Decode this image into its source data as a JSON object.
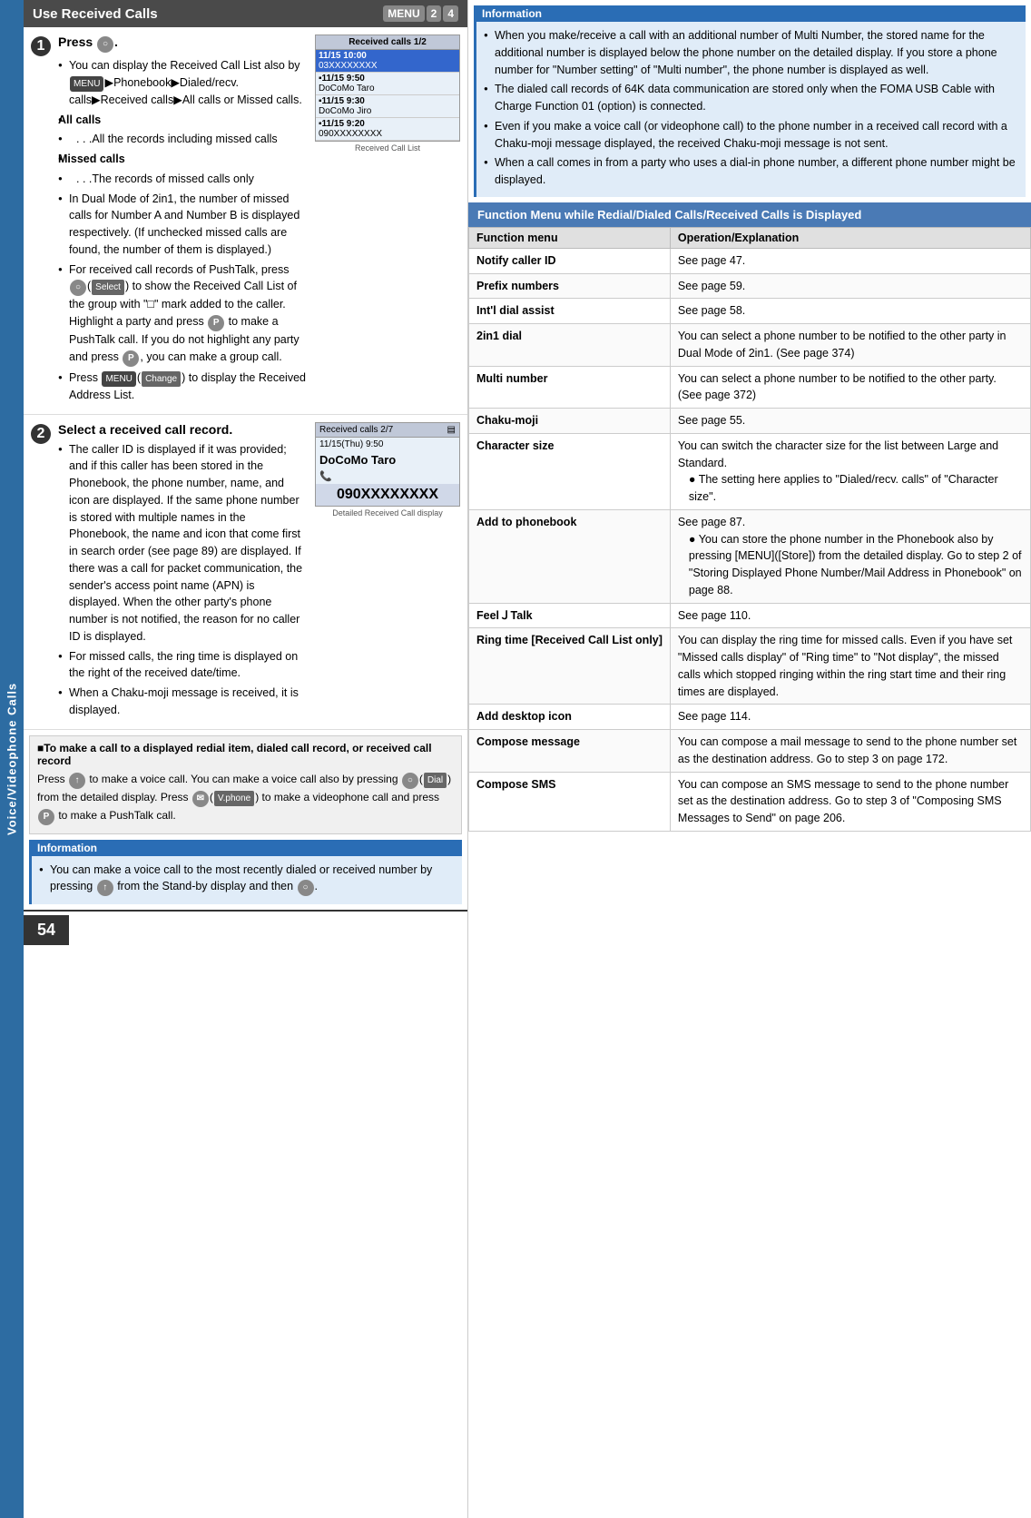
{
  "page_number": "54",
  "side_label": "Voice/Videophone Calls",
  "section_title": "Use Received Calls",
  "menu_numbers": [
    "2",
    "4"
  ],
  "step1": {
    "title": "Press",
    "key": "○",
    "bullets": [
      "You can display the Received Call List also by [MENU]▶Phonebook▶Dialed/recv. calls▶Received calls▶All calls or Missed calls.",
      "All calls",
      "　. . .All the records including missed calls",
      "Missed calls",
      "　. . .The records of missed calls only",
      "In Dual Mode of 2in1, the number of missed calls for Number A and Number B is displayed respectively. (If unchecked missed calls are found, the number of them is displayed.)",
      "For received call records of PushTalk, press ○([Select]) to show the Received Call List of the group with \"□\" mark added to the caller. Highlight a party and press [P] to make a PushTalk call. If you do not highlight any party and press [P], you can make a group call.",
      "Press [MENU]([Change]) to display the Received Address List."
    ],
    "screen_title": "Received calls  1/2",
    "screen_rows": [
      {
        "time": "11/15 10:00",
        "name": "03XXXXXXXX",
        "selected": true
      },
      {
        "time": "11/15  9:50",
        "name": "DoCoMo Taro",
        "selected": false
      },
      {
        "time": "11/15  9:30",
        "name": "DoCoMo Jiro",
        "selected": false
      },
      {
        "time": "11/15  9:20",
        "name": "090XXXXXXXX",
        "selected": false
      }
    ],
    "screen_label": "Received Call List"
  },
  "step2": {
    "title": "Select a received call record.",
    "bullets": [
      "The caller ID is displayed if it was provided; and if this caller has been stored in the Phonebook, the phone number, name, and icon are displayed. If the same phone number is stored with multiple names in the Phonebook, the name and icon that come first in search order (see page 89) are displayed. If there was a call for packet communication, the sender's access point name (APN) is displayed. When the other party's phone number is not notified, the reason for no caller ID is displayed.",
      "For missed calls, the ring time is displayed on the right of the received date/time.",
      "When a Chaku-moji message is received, it is displayed."
    ],
    "screen_title": "Received calls  2/7",
    "screen_date": "11/15(Thu)  9:50",
    "screen_name": "DoCoMo Taro",
    "screen_number": "090XXXXXXXX",
    "screen_label": "Detailed Received Call display"
  },
  "call_box": {
    "title": "■To make a call to a displayed redial item, dialed call record, or received call record",
    "text1": "Press [↑] to make a voice call. You can make a voice call also by pressing ○([Dial]) from the detailed display. Press [✉]([V.phone]) to make a videophone call and press [P] to make a PushTalk call."
  },
  "information_section": {
    "title": "Information",
    "bullets": [
      "You can make a voice call to the most recently dialed or received number by pressing [↑] from the Stand-by display and then ○."
    ]
  },
  "right_info_bullets": [
    "When you make/receive a call with an additional number of Multi Number, the stored name for the additional number is displayed below the phone number on the detailed display. If you store a phone number for \"Number setting\" of \"Multi number\", the phone number is displayed as well.",
    "The dialed call records of 64K data communication are stored only when the FOMA USB Cable with Charge Function 01 (option) is connected.",
    "Even if you make a voice call (or videophone call) to the phone number in a received call record with a Chaku-moji message displayed, the received Chaku-moji message is not sent.",
    "When a call comes in from a party who uses a dial-in phone number, a different phone number might be displayed."
  ],
  "function_menu_title": "Function Menu while Redial/Dialed Calls/Received Calls is Displayed",
  "table_headers": [
    "Function menu",
    "Operation/Explanation"
  ],
  "table_rows": [
    {
      "name": "Notify caller ID",
      "desc": "See page 47."
    },
    {
      "name": "Prefix numbers",
      "desc": "See page 59."
    },
    {
      "name": "Int'l dial assist",
      "desc": "See page 58."
    },
    {
      "name": "2in1 dial",
      "desc": "You can select a phone number to be notified to the other party in Dual Mode of 2in1. (See page 374)"
    },
    {
      "name": "Multi number",
      "desc": "You can select a phone number to be notified to the other party. (See page 372)"
    },
    {
      "name": "Chaku-moji",
      "desc": "See page 55."
    },
    {
      "name": "Character size",
      "desc": "You can switch the character size for the list between Large and Standard.\n●The setting here applies to \"Dialed/recv. calls\" of \"Character size\"."
    },
    {
      "name": "Add to phonebook",
      "desc": "See page 87.\n●You can store the phone number in the Phonebook also by pressing [MENU]([Store]) from the detailed display. Go to step 2 of \"Storing Displayed Phone Number/Mail Address in Phonebook\" on page 88."
    },
    {
      "name": "FeelＪTalk",
      "desc": "See page 110."
    },
    {
      "name": "Ring time\n[Received Call List only]",
      "desc": "You can display the ring time for missed calls. Even if you have set \"Missed calls display\" of \"Ring time\" to \"Not display\", the missed calls which stopped ringing within the ring start time and their ring times are displayed."
    },
    {
      "name": "Add desktop icon",
      "desc": "See page 114."
    },
    {
      "name": "Compose message",
      "desc": "You can compose a mail message to send to the phone number set as the destination address. Go to step 3 on page 172."
    },
    {
      "name": "Compose SMS",
      "desc": "You can compose an SMS message to send to the phone number set as the destination address. Go to step 3 of \"Composing SMS Messages to Send\" on page 206."
    }
  ]
}
